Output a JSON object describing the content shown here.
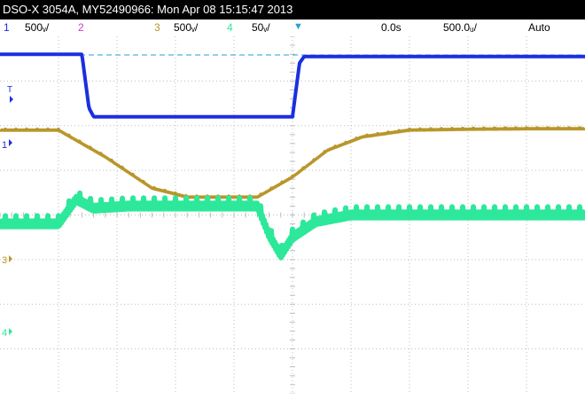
{
  "header": {
    "title": "DSO-X 3054A, MY52490966: Mon Apr 08 15:15:47 2013"
  },
  "status": {
    "ch1_num": "1",
    "ch1_scale": "500ᵥ/",
    "ch2_num": "2",
    "ch3_num": "3",
    "ch3_scale": "500ᵥ/",
    "ch4_num": "4",
    "ch4_scale": "50ᵥ/",
    "time_pos": "0.0s",
    "time_scale": "500.0ᵤ/",
    "trigger_mode": "Auto"
  },
  "markers": {
    "trigger_level": "T",
    "ch1_ground": "1",
    "ch3_ground": "3",
    "ch4_ground": "4"
  },
  "colors": {
    "ch1": "#1a2fe0",
    "ch2": "#c83cc8",
    "ch3": "#b8962a",
    "ch4": "#2de89a",
    "trigger_line": "#2a9fd6",
    "grid": "#bdbdbd"
  },
  "chart_data": {
    "type": "line",
    "title": "",
    "xlabel": "",
    "ylabel": "",
    "grid": true,
    "x_divisions": 10,
    "y_divisions": 8,
    "xlim": [
      -2.5,
      2.5
    ],
    "x_unit": "ms",
    "series": [
      {
        "channel": "1",
        "x": [
          -2.5,
          -1.8,
          -1.78,
          -1.74,
          -1.7,
          0.0,
          0.02,
          0.06,
          0.1,
          2.5
        ],
        "y": [
          3.6,
          3.6,
          3.2,
          2.4,
          2.2,
          2.2,
          2.6,
          3.4,
          3.55,
          3.55
        ]
      },
      {
        "channel": "3",
        "x": [
          -2.5,
          -2.0,
          -1.6,
          -1.2,
          -0.9,
          -0.6,
          -0.3,
          0.0,
          0.3,
          0.6,
          1.0,
          1.5,
          2.0,
          2.5
        ],
        "y": [
          1.9,
          1.9,
          1.3,
          0.6,
          0.4,
          0.4,
          0.4,
          0.85,
          1.45,
          1.75,
          1.9,
          1.92,
          1.93,
          1.93
        ],
        "noise": 0.03
      },
      {
        "channel": "4",
        "x": [
          -2.5,
          -2.0,
          -1.85,
          -1.7,
          -1.4,
          -1.0,
          -0.6,
          -0.3,
          -0.2,
          -0.1,
          0.0,
          0.2,
          0.5,
          1.0,
          1.5,
          2.0,
          2.5
        ],
        "y": [
          -0.2,
          -0.2,
          0.35,
          0.15,
          0.2,
          0.2,
          0.2,
          0.2,
          -0.45,
          -0.9,
          -0.5,
          -0.15,
          0.0,
          0.0,
          0.0,
          0.0,
          0.0
        ],
        "noise": 0.18
      }
    ]
  }
}
